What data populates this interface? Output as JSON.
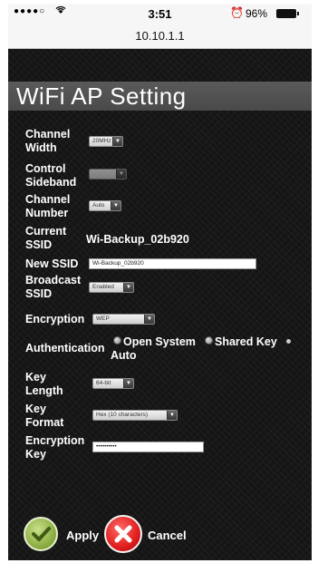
{
  "status_bar": {
    "signal": "●●●●○",
    "wifi_icon": "wifi-icon",
    "time": "3:51",
    "alarm_icon": "alarm-icon",
    "battery": "96%"
  },
  "url": "10.10.1.1",
  "page_title": "WiFi AP Setting",
  "fields": {
    "channel_width": {
      "label1": "Channel",
      "label2": "Width",
      "value": "20MHz"
    },
    "control_sideband": {
      "label1": "Control",
      "label2": "Sideband",
      "value": ""
    },
    "channel_number": {
      "label1": "Channel",
      "label2": "Number",
      "value": "Auto"
    },
    "current_ssid": {
      "label1": "Current",
      "label2": "SSID",
      "value": "Wi-Backup_02b920"
    },
    "new_ssid": {
      "label": "New SSID",
      "value": "Wi-Backup_02b920"
    },
    "broadcast_ssid": {
      "label1": "Broadcast",
      "label2": "SSID",
      "value": "Enabled"
    },
    "encryption": {
      "label": "Encryption",
      "value": "WEP"
    },
    "authentication": {
      "label": "Authentication",
      "options": [
        "Open System",
        "Shared Key",
        "Auto"
      ]
    },
    "key_length": {
      "label1": "Key",
      "label2": "Length",
      "value": "64-bit"
    },
    "key_format": {
      "label1": "Key",
      "label2": "Format",
      "value": "Hex (10 characters)"
    },
    "encryption_key": {
      "label1": "Encryption",
      "label2": "Key",
      "value": "••••••••••"
    }
  },
  "buttons": {
    "apply": "Apply",
    "cancel": "Cancel"
  },
  "colors": {
    "background": "#141414",
    "titlebar": "#4f4f4f",
    "apply": "#8fb046",
    "cancel": "#e01e1e"
  }
}
